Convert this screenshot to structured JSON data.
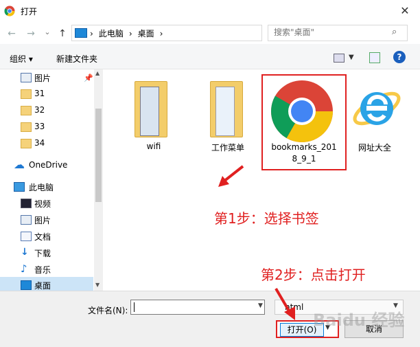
{
  "window": {
    "title": "打开",
    "close_glyph": "✕"
  },
  "nav": {
    "back_glyph": "←",
    "forward_glyph": "→",
    "recent_glyph": "⌄",
    "up_glyph": "↑",
    "breadcrumb": [
      "›",
      "此电脑",
      "›",
      "桌面",
      "›"
    ],
    "refresh_glyph": "↻",
    "search_placeholder": "搜索\"桌面\"",
    "search_glyph": "⌕"
  },
  "toolbar": {
    "organize_label": "组织 ▾",
    "new_folder_label": "新建文件夹",
    "help_label": "?"
  },
  "sidebar": {
    "items": [
      {
        "label": "图片",
        "icon": "picture-icon"
      },
      {
        "label": "31",
        "icon": "folder-icon"
      },
      {
        "label": "32",
        "icon": "folder-icon"
      },
      {
        "label": "33",
        "icon": "folder-icon"
      },
      {
        "label": "34",
        "icon": "folder-icon"
      },
      {
        "label": "OneDrive",
        "icon": "cloud-icon"
      },
      {
        "label": "此电脑",
        "icon": "computer-icon"
      },
      {
        "label": "视频",
        "icon": "video-icon"
      },
      {
        "label": "图片",
        "icon": "picture-icon"
      },
      {
        "label": "文档",
        "icon": "document-icon"
      },
      {
        "label": "下载",
        "icon": "download-icon"
      },
      {
        "label": "音乐",
        "icon": "music-icon"
      },
      {
        "label": "桌面",
        "icon": "desktop-icon"
      }
    ],
    "pin_glyph": "📌"
  },
  "files": [
    {
      "name": "wifi",
      "icon": "folder-icon"
    },
    {
      "name": "工作菜单",
      "icon": "folder-icon"
    },
    {
      "name_line1": "bookmarks_201",
      "name_line2": "8_9_1",
      "icon": "chrome-icon"
    },
    {
      "name": "网址大全",
      "icon": "ie-icon"
    }
  ],
  "annotations": {
    "step1": "第1步：选择书签",
    "step2": "第2步：点击打开",
    "color": "#e02020"
  },
  "bottom": {
    "filename_label": "文件名(N):",
    "filename_value": "",
    "filetype_value": "html",
    "open_label": "打开(O)",
    "cancel_label": "取消"
  },
  "watermark": "Baidu 经验"
}
